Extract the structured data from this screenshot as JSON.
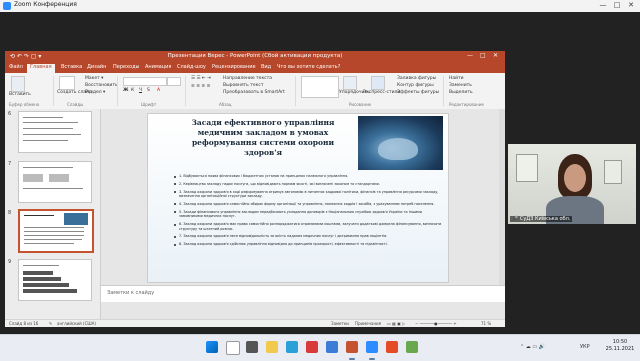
{
  "zoom": {
    "title": "Zoom Конференция",
    "controls": [
      "—",
      "□",
      "✕"
    ]
  },
  "ppt": {
    "window_title": "Презентация Верес - PowerPoint (Сбой активации продукта)",
    "qat": "⟲ ↶ ↷ ▢ ▾",
    "tabs": [
      "Файл",
      "Главная",
      "Вставка",
      "Дизайн",
      "Переходы",
      "Анимация",
      "Слайд-шоу",
      "Рецензирование",
      "Вид",
      "Что вы хотите сделать?"
    ],
    "active_tab": "Главная",
    "ribbon": {
      "paste": "Вставить",
      "new_slide": "Создать слайд",
      "layout": "Макет ▾",
      "reset": "Восстановить",
      "section": "Раздел ▾",
      "arrange": "Упорядочить",
      "quick_styles": "Экспресс-стили",
      "fill": "Заливка фигуры",
      "outline": "Контур фигуры",
      "effects": "Эффекты фигуры",
      "find": "Найти",
      "replace": "Заменить",
      "select": "Выделить",
      "text_dir": "Направление текста",
      "align_text": "Выровнять текст",
      "smartart": "Преобразовать в SmartArt",
      "groups": [
        "Буфер обмена",
        "Слайды",
        "Шрифт",
        "Абзац",
        "Рисование",
        "Редактирование"
      ]
    },
    "thumbnails": [
      {
        "number": "6"
      },
      {
        "number": "7"
      },
      {
        "number": "8",
        "selected": true
      },
      {
        "number": "9"
      }
    ],
    "slide": {
      "title": "Засади ефективного управління медичним закладом в умовах реформування системи охорони здоров'я",
      "bullets": [
        "1. Відбувається поява фінансових і бюджетних установ на принципах належного управління.",
        "2. Керівництво закладу надає послуги, що відповідають нормам якості, які визначені законом та стандартами.",
        "3. Заклад охорони здоров'я в ході реформування отримує автономію в питаннях кадрової політики, фінансів та управління ресурсами закладу, визначення організаційної структури закладу.",
        "4. Заклад охорони здоров'я самостійно обирає форму організації та управління, належних кадрів і засобів, з урахуванням потреб населення.",
        "5. Засади фінансового управління закладом передбачають укладання договорів з Національною службою здоров'я України та іншими замовниками медичних послуг.",
        "6. Заклад охорони здоров'я має право самостійно розпоряджатися отриманими коштами, залучати додаткові джерела фінансування, визначати структуру та штатний розпис.",
        "7. Заклад охорони здоров'я несе відповідальність за якість наданих медичних послуг і дотримання прав пацієнтів.",
        "8. Заклад охорони здоров'я здійснює управління відповідно до принципів прозорості, ефективності та підзвітності."
      ]
    },
    "notes_placeholder": "Заметки к слайду",
    "status": {
      "slide_info": "Слайд 8 из 16",
      "language": "английский (США)",
      "notes": "Заметки",
      "comments": "Примечания",
      "zoom": "71 %"
    }
  },
  "video": {
    "name": "СуДЗ Київська обл."
  },
  "taskbar": {
    "tray_lang": "УКР",
    "time": "10:50",
    "date": "25.11.2021"
  }
}
